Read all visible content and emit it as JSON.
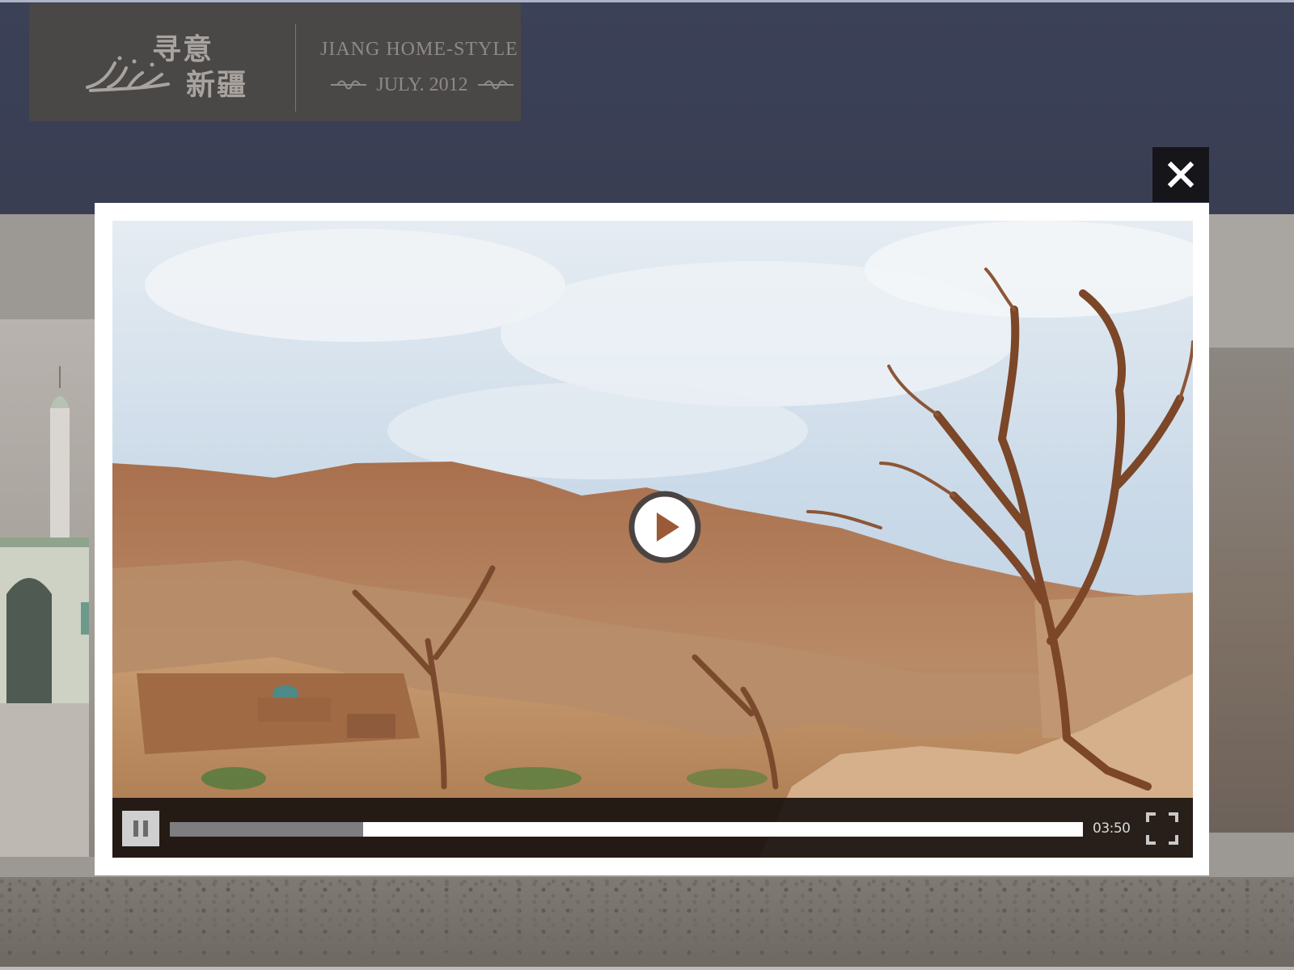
{
  "header": {
    "logo_cn_line1": "寻意",
    "logo_cn_line2": "新疆",
    "logo_en": "JIANG HOME-STYLE",
    "logo_date": "JULY. 2012"
  },
  "video_player": {
    "time": "03:50",
    "progress": 0.212,
    "state": "paused",
    "icons": {
      "close": "close-icon",
      "play": "play-icon",
      "pause": "pause-icon",
      "fullscreen": "fullscreen-icon"
    }
  },
  "colors": {
    "header_bg": "#3b4157",
    "modal_bg": "#ffffff",
    "close_bg": "#15151a",
    "control_bar": "#191210",
    "progress_fill": "#7e7e80",
    "progress_track": "#ffffff"
  }
}
